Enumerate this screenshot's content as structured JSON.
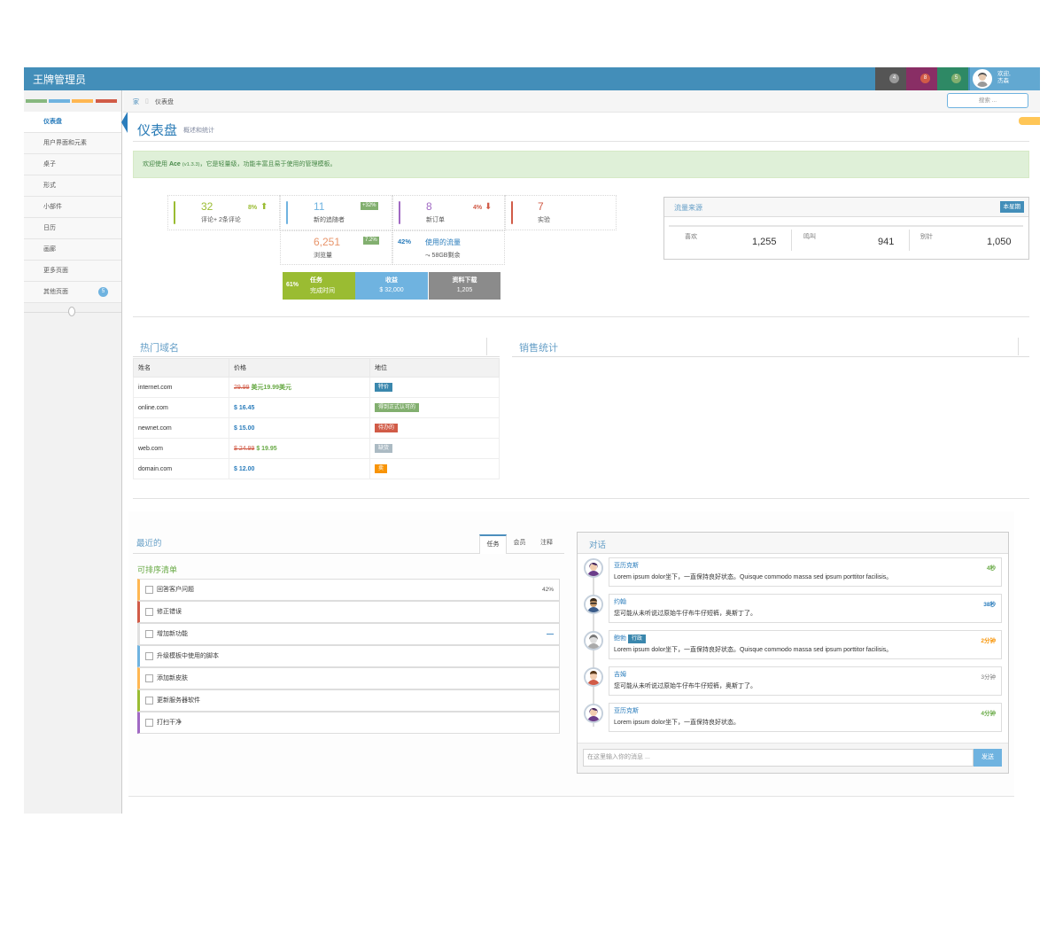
{
  "navbar": {
    "brand": "王牌管理员",
    "badges": [
      {
        "count": "4",
        "bg": "#555555",
        "badge_color": "#999999"
      },
      {
        "count": "8",
        "bg": "#892e65",
        "badge_color": "#d15b47"
      },
      {
        "count": "5",
        "bg": "#2e8965",
        "badge_color": "#82af6f"
      }
    ],
    "user_greeting": "欢迎,",
    "user_name": "杰森"
  },
  "sidebar": {
    "shortcut_colors": [
      "#87b87f",
      "#6fb3e0",
      "#ffb752",
      "#d15b47"
    ],
    "items": [
      {
        "label": "仪表盘",
        "active": true
      },
      {
        "label": "用户界面和元素"
      },
      {
        "label": "桌子"
      },
      {
        "label": "形式"
      },
      {
        "label": "小部件"
      },
      {
        "label": "日历"
      },
      {
        "label": "画廊"
      },
      {
        "label": "更多页面"
      },
      {
        "label": "其他页面",
        "badge": "5"
      }
    ]
  },
  "breadcrumb": {
    "home": "家",
    "current": "仪表盘"
  },
  "search": {
    "placeholder": "搜索 ..."
  },
  "page": {
    "title": "仪表盘",
    "subtitle": "概述和统计"
  },
  "alert": {
    "prefix": "欢迎使用 ",
    "app": "Ace",
    "version": "(v1.3.3)",
    "suffix": "，它是轻量级，功能丰富且易于使用的管理模板。"
  },
  "infoboxes": {
    "comments": {
      "value": "32",
      "label": "评论+ 2条评论",
      "stat": "8%",
      "color": "#6fb3e0",
      "text_color": "#9abc32"
    },
    "followers": {
      "value": "11",
      "label": "新的追随者",
      "stat": "+32%",
      "color": "#6fb3e0"
    },
    "orders": {
      "value": "8",
      "label": "新订单",
      "stat": "4%",
      "color": "#b74635",
      "text_color": "#a069c3"
    },
    "experiments": {
      "value": "7",
      "label": "实验",
      "color": "#d15b47"
    },
    "pageviews": {
      "value": "6,251",
      "label": "浏览量",
      "stat": "7.2%"
    },
    "traffic": {
      "percent": "42%",
      "label": "使用的流量",
      "remain": "58GB剩余"
    }
  },
  "stat_boxes": [
    {
      "percent": "61%",
      "title": "任务",
      "sub": "完成时间",
      "bg": "#9abc32"
    },
    {
      "title": "收益",
      "sub": "$ 32,000",
      "bg": "#6fb3e0"
    },
    {
      "title": "资料下载",
      "sub": "1,205",
      "bg": "#8b8b8b"
    }
  ],
  "traffic_widget": {
    "title": "流量来源",
    "badge": "本星期",
    "items": [
      {
        "label": "喜欢",
        "value": "1,255"
      },
      {
        "label": "鸣叫",
        "value": "941"
      },
      {
        "label": "别针",
        "value": "1,050"
      }
    ]
  },
  "domains": {
    "title": "热门域名",
    "headers": [
      "姓名",
      "价格",
      "地位"
    ],
    "rows": [
      {
        "name": "internet.com",
        "old_price": "29.99",
        "price": "美元19.99美元",
        "status": "特价",
        "status_color": "#3a87ad"
      },
      {
        "name": "online.com",
        "price": "$ 16.45",
        "status": "得到正式认可的",
        "status_color": "#82af6f"
      },
      {
        "name": "newnet.com",
        "price": "$ 15.00",
        "status": "待办的",
        "status_color": "#d15b47"
      },
      {
        "name": "web.com",
        "old_price": "$ 24.99",
        "price": "$ 19.95",
        "status": "缺货",
        "status_color": "#abbac3"
      },
      {
        "name": "domain.com",
        "price": "$ 12.00",
        "status": "卖",
        "status_color": "#f89406"
      }
    ]
  },
  "sales": {
    "title": "销售统计"
  },
  "recent": {
    "title": "最近的",
    "tabs": [
      "任务",
      "会员",
      "注释"
    ],
    "list_title": "可排序清单",
    "tasks": [
      {
        "label": "回答客户问题",
        "color": "#ffb752",
        "extra": "42%"
      },
      {
        "label": "修正错误",
        "color": "#d15b47"
      },
      {
        "label": "增加新功能",
        "color": "#e0e0e0",
        "extra": "—"
      },
      {
        "label": "升级模板中使用的脚本",
        "color": "#6fb3e0"
      },
      {
        "label": "添加新皮肤",
        "color": "#ffb752"
      },
      {
        "label": "更新服务器软件",
        "color": "#9abc32"
      },
      {
        "label": "打扫干净",
        "color": "#a069c3"
      }
    ]
  },
  "conversation": {
    "title": "对话",
    "messages": [
      {
        "name": "亚历克斯",
        "time": "4秒",
        "time_color": "#69aa46",
        "text": "Lorem ipsum dolor坐下，一直保持良好状态。Quisque commodo massa sed ipsum porttitor facilisis。"
      },
      {
        "name": "约翰",
        "time": "38秒",
        "time_color": "#2b7dbc",
        "text": "您可能从未听说过原始牛仔布牛仔短裤，奥斯丁了。"
      },
      {
        "name": "鲍勃",
        "tag": "行政",
        "time": "2分钟",
        "time_color": "#f89406",
        "text": "Lorem ipsum dolor坐下，一直保持良好状态。Quisque commodo massa sed ipsum porttitor facilisis。"
      },
      {
        "name": "吉姆",
        "time": "3分钟",
        "time_color": "#777777",
        "text": "您可能从未听说过原始牛仔布牛仔短裤，奥斯丁了。"
      },
      {
        "name": "亚历克斯",
        "time": "4分钟",
        "time_color": "#69aa46",
        "text": "Lorem ipsum dolor坐下，一直保持良好状态。"
      }
    ],
    "input_placeholder": "在这里输入你的消息 ...",
    "send": "发送"
  }
}
